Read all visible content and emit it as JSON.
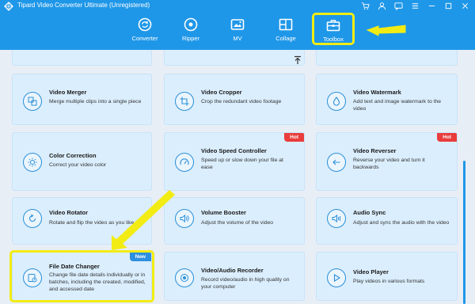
{
  "app": {
    "title": "Tipard Video Converter Ultimate (Unregistered)"
  },
  "window_icons": [
    "cart-icon",
    "user-icon",
    "chat-icon",
    "menu-icon",
    "minimize-icon",
    "maximize-icon",
    "close-icon"
  ],
  "nav": {
    "items": [
      {
        "label": "Converter",
        "icon": "converter-icon"
      },
      {
        "label": "Ripper",
        "icon": "ripper-icon"
      },
      {
        "label": "MV",
        "icon": "mv-icon"
      },
      {
        "label": "Collage",
        "icon": "collage-icon"
      },
      {
        "label": "Toolbox",
        "icon": "toolbox-icon",
        "active": true
      }
    ]
  },
  "tools": [
    {
      "title": "Video Merger",
      "desc": "Merge multiple clips into a single piece",
      "icon": "merge-icon"
    },
    {
      "title": "Video Cropper",
      "desc": "Crop the redundant video footage",
      "icon": "crop-icon"
    },
    {
      "title": "Video Watermark",
      "desc": "Add text and image watermark to the video",
      "icon": "watermark-icon"
    },
    {
      "title": "Color Correction",
      "desc": "Correct your video color",
      "icon": "color-icon"
    },
    {
      "title": "Video Speed Controller",
      "desc": "Speed up or slow down your file at ease",
      "icon": "speed-icon",
      "badge": "Hot"
    },
    {
      "title": "Video Reverser",
      "desc": "Reverse your video and turn it backwards",
      "icon": "reverse-icon",
      "badge": "Hot"
    },
    {
      "title": "Video Rotator",
      "desc": "Rotate and flip the video as you like",
      "icon": "rotate-icon"
    },
    {
      "title": "Volume Booster",
      "desc": "Adjust the volume of the video",
      "icon": "volume-icon"
    },
    {
      "title": "Audio Sync",
      "desc": "Adjust and sync the audio with the video",
      "icon": "sync-icon"
    },
    {
      "title": "File Date Changer",
      "desc": "Change file date details individually or in batches, including the created, modified, and accessed date",
      "icon": "date-icon",
      "badge": "New"
    },
    {
      "title": "Video/Audio Recorder",
      "desc": "Record video/audio in high quality on your computer",
      "icon": "record-icon"
    },
    {
      "title": "Video Player",
      "desc": "Play videos in various formats",
      "icon": "play-icon"
    }
  ],
  "colors": {
    "brand": "#1f97e8",
    "card_bg": "#dbeefd",
    "hot": "#ea3c3c",
    "new": "#2d8fe0",
    "annotation": "#f2ec14"
  }
}
